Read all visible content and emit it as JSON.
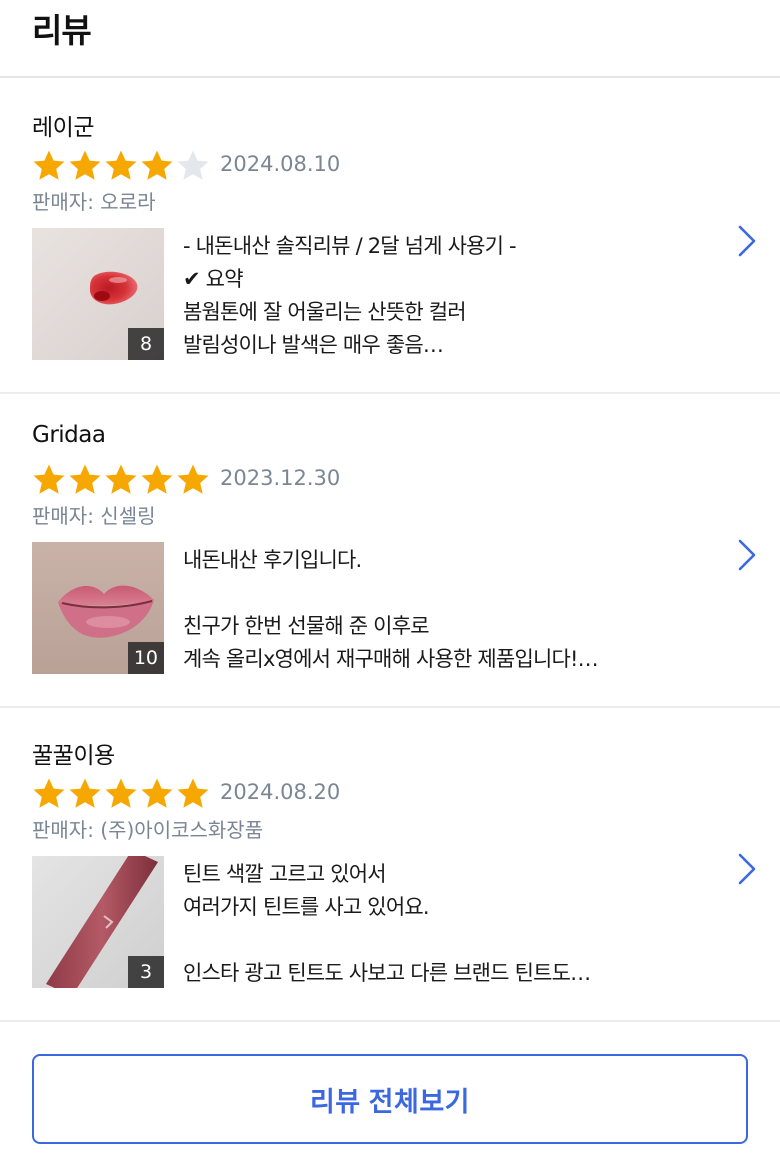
{
  "header": {
    "title": "리뷰"
  },
  "colors": {
    "star_on": "#f7a800",
    "star_off": "#e4e7eb",
    "meta": "#7a8694",
    "accent": "#3b68e0"
  },
  "reviews": [
    {
      "author": "레이군",
      "rating": 4,
      "date": "2024.08.10",
      "seller": "판매자: 오로라",
      "photo_count": "8",
      "photo_icon": "lip-tint-swatch-on-skin",
      "text": "- 내돈내산 솔직리뷰 / 2달 넘게 사용기 -\n✔ 요약\n봄웜톤에 잘 어울리는 산뜻한 컬러\n발림성이나 발색은 매우 좋음…"
    },
    {
      "author": "Gridaa",
      "rating": 5,
      "date": "2023.12.30",
      "seller": "판매자: 신셀링",
      "photo_count": "10",
      "photo_icon": "lips-photo",
      "text": "내돈내산 후기입니다.\n\n친구가 한번 선물해 준 이후로\n계속 올리x영에서 재구매해 사용한 제품입니다!…"
    },
    {
      "author": "꿀꿀이용",
      "rating": 5,
      "date": "2024.08.20",
      "seller": "판매자: (주)아이코스화장품",
      "photo_count": "3",
      "photo_icon": "tint-tube-photo",
      "text": "틴트 색깔 고르고 있어서\n여러가지 틴트를 사고 있어요.\n\n인스타 광고 틴트도 사보고 다른 브랜드 틴트도…"
    }
  ],
  "footer": {
    "view_all_label": "리뷰 전체보기"
  }
}
